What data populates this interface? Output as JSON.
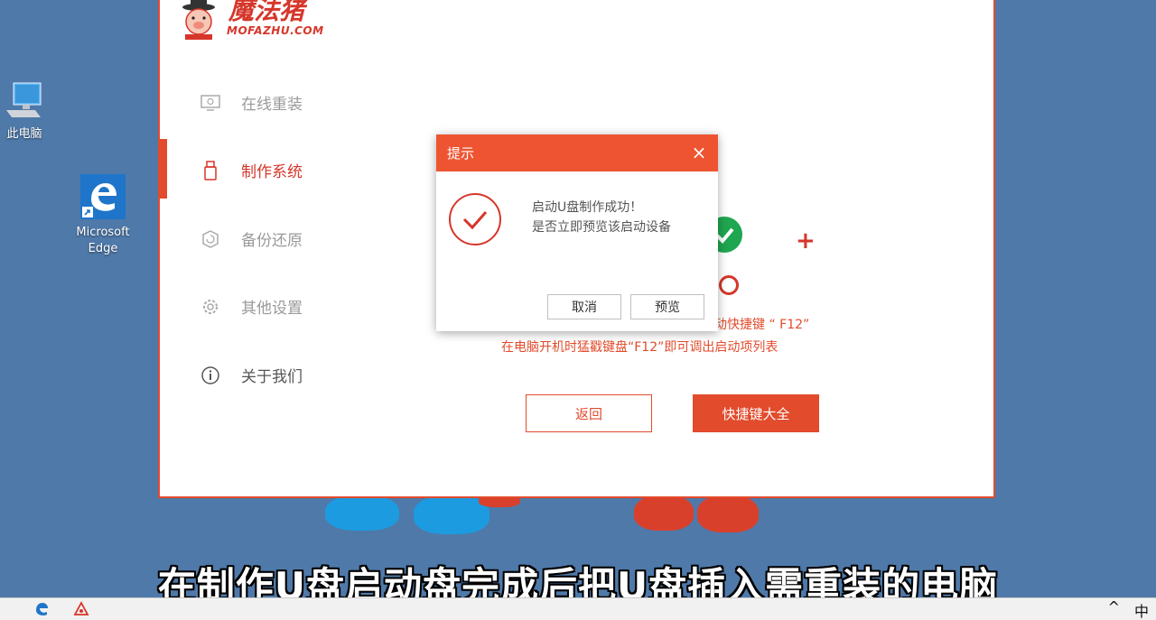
{
  "desktop": {
    "icons": [
      {
        "label": "此电脑"
      },
      {
        "label": "Microsoft Edge"
      }
    ]
  },
  "app": {
    "logo": {
      "title": "魔法猪",
      "subtitle": "MOFAZHU.COM"
    },
    "sidebar": {
      "items": [
        {
          "label": "在线重装"
        },
        {
          "label": "制作系统"
        },
        {
          "label": "备份还原"
        },
        {
          "label": "其他设置"
        },
        {
          "label": "关于我们"
        }
      ],
      "active_index": 1
    },
    "hint": {
      "line1": "动快捷键 “ F12”",
      "line2": "在电脑开机时猛戳键盘“F12”即可调出启动项列表"
    },
    "buttons": {
      "back": "返回",
      "shortcut_keys": "快捷键大全"
    },
    "plus_sign": "+"
  },
  "dialog": {
    "title": "提示",
    "close_glyph": "×",
    "message_line1": "启动U盘制作成功！",
    "message_line2": "是否立即预览该启动设备",
    "cancel_label": "取消",
    "preview_label": "预览"
  },
  "subtitle": "在制作U盘启动盘完成后把U盘插入需重装的电脑",
  "taskbar": {
    "tray_chevron": "^",
    "ime_indicator": "中"
  },
  "colors": {
    "accent": "#e24b2c",
    "dialog_header": "#ee5431",
    "desktop": "#4f79a9",
    "success_green": "#1fa650"
  }
}
